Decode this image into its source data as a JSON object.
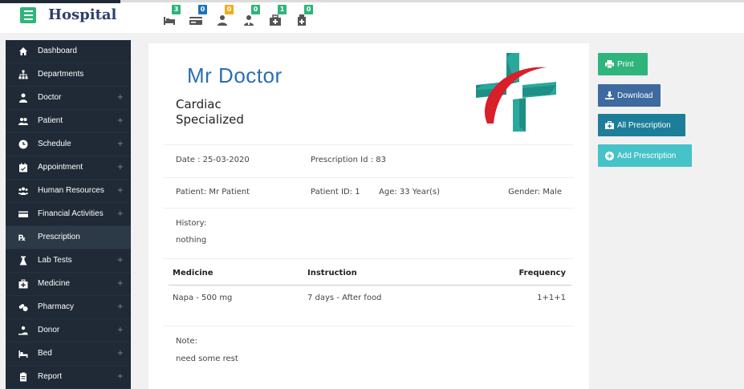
{
  "app": {
    "brand": "Hospital"
  },
  "header": {
    "badges": [
      {
        "icon": "bed-icon",
        "count": "3",
        "color": "#2fb47c"
      },
      {
        "icon": "payment-card-icon",
        "count": "0",
        "color": "#1e73b8"
      },
      {
        "icon": "patient-icon",
        "count": "0",
        "color": "#f0ad1e"
      },
      {
        "icon": "doctor-icon",
        "count": "0",
        "color": "#2fb47c"
      },
      {
        "icon": "medicine-kit-icon",
        "count": "1",
        "color": "#2fb47c"
      },
      {
        "icon": "prescription-icon",
        "count": "0",
        "color": "#2fb47c"
      }
    ]
  },
  "sidebar": {
    "items": [
      {
        "label": "Dashboard",
        "icon": "home-icon",
        "expandable": false
      },
      {
        "label": "Departments",
        "icon": "sitemap-icon",
        "expandable": false
      },
      {
        "label": "Doctor",
        "icon": "doctor-icon",
        "expandable": true
      },
      {
        "label": "Patient",
        "icon": "users-icon",
        "expandable": true
      },
      {
        "label": "Schedule",
        "icon": "clock-icon",
        "expandable": true
      },
      {
        "label": "Appointment",
        "icon": "calendar-icon",
        "expandable": true
      },
      {
        "label": "Human Resources",
        "icon": "users-group-icon",
        "expandable": true
      },
      {
        "label": "Financial Activities",
        "icon": "money-icon",
        "expandable": true
      },
      {
        "label": "Prescription",
        "icon": "prescription-rx-icon",
        "expandable": false,
        "active": true
      },
      {
        "label": "Lab Tests",
        "icon": "flask-icon",
        "expandable": true
      },
      {
        "label": "Medicine",
        "icon": "medkit-icon",
        "expandable": true
      },
      {
        "label": "Pharmacy",
        "icon": "pills-icon",
        "expandable": true
      },
      {
        "label": "Donor",
        "icon": "donor-hand-icon",
        "expandable": true
      },
      {
        "label": "Bed",
        "icon": "bed-icon",
        "expandable": true
      },
      {
        "label": "Report",
        "icon": "report-icon",
        "expandable": true
      }
    ],
    "plus_glyph": "+"
  },
  "prescription": {
    "doctor_name": "Mr Doctor",
    "specialization": "Cardiac Specialized",
    "date": "Date : 25-03-2020",
    "prescription_id": "Prescription Id : 83",
    "patient": "Patient: Mr Patient",
    "patient_id": "Patient ID: 1",
    "age": "Age: 33 Year(s)",
    "gender": "Gender: Male",
    "history_label": "History:",
    "history_value": "nothing",
    "table": {
      "headers": [
        "Medicine",
        "Instruction",
        "Frequency"
      ],
      "rows": [
        [
          "Napa - 500 mg",
          "7 days - After food",
          "1+1+1"
        ]
      ]
    },
    "note_label": "Note:",
    "note_value": "need some rest"
  },
  "actions": {
    "print": {
      "label": "Print",
      "color": "#2fb47c"
    },
    "download": {
      "label": "Download",
      "color": "#3d6a9f"
    },
    "all_prescription": {
      "label": "All Prescription",
      "color": "#1c7e99"
    },
    "add_prescription": {
      "label": "Add Prescription",
      "color": "#46c2c9"
    }
  }
}
